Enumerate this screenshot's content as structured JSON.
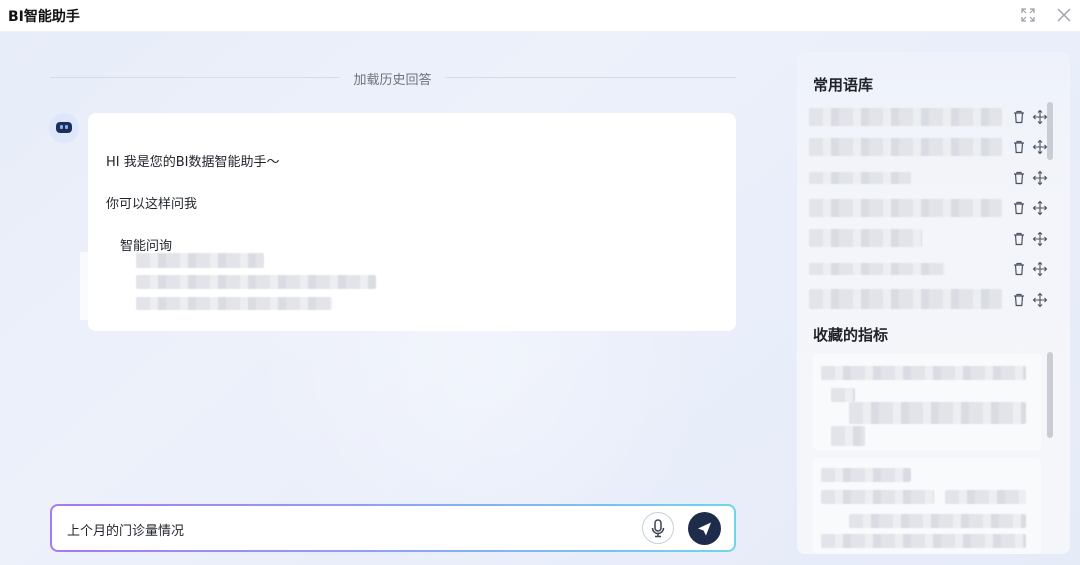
{
  "app": {
    "title": "BI智能助手",
    "window_controls": {
      "expand_icon": "expand-icon",
      "close_icon": "close-icon"
    }
  },
  "chat": {
    "history_label": "加载历史回答",
    "greeting": "HI  我是您的BI数据智能助手～",
    "prompt_intro": "你可以这样问我",
    "category": "智能问询",
    "input_value": "上个月的门诊量情况"
  },
  "panel": {
    "phrases_title": "常用语库",
    "favorites_title": "收藏的指标",
    "phrase_count": 7,
    "row_icons": [
      "trash-icon",
      "drag-move-icon"
    ]
  },
  "colors": {
    "send_button": "#1e2b4a",
    "input_gradient_start": "#a678f5",
    "input_gradient_end": "#6fd6ea",
    "bot_avatar": "#1f2e57"
  }
}
